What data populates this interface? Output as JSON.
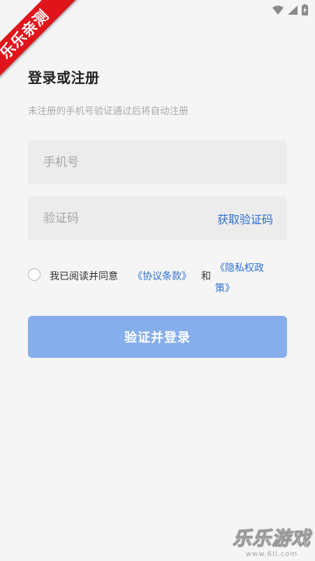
{
  "watermark_ribbon": "乐乐亲测",
  "header": {
    "title": "登录或注册",
    "subtitle": "未注册的手机号验证通过后将自动注册"
  },
  "form": {
    "phone": {
      "placeholder": "手机号",
      "value": ""
    },
    "code": {
      "placeholder": "验证码",
      "value": "",
      "get_code_label": "获取验证码"
    }
  },
  "agreement": {
    "checked": false,
    "prefix": "我已阅读并同意",
    "terms_link": "《协议条款》",
    "conjunction": "和",
    "privacy_link": "《隐私权政策》"
  },
  "submit": {
    "label": "验证并登录"
  },
  "watermark_bottom": {
    "main": "乐乐游戏",
    "sub": "www.6ll.com"
  },
  "colors": {
    "accent": "#2f6fd0",
    "button": "#86aeea",
    "ribbon": "#e0151c",
    "background": "#f5f5f5"
  },
  "icons": [
    "wifi-icon",
    "signal-icon",
    "battery-charging-icon",
    "check-circle-icon"
  ]
}
